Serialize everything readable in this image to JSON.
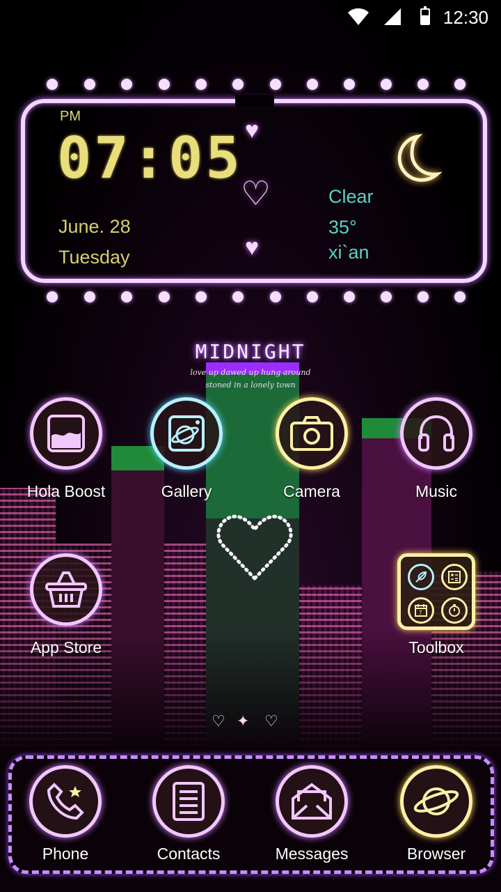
{
  "status_bar": {
    "time": "12:30"
  },
  "clock_widget": {
    "period": "PM",
    "time": "07:05",
    "date": "June. 28",
    "weekday": "Tuesday",
    "weather": {
      "condition": "Clear",
      "temperature": "35°",
      "city": "xi`an"
    }
  },
  "theme_label": {
    "title": "MIDNIGHT",
    "tagline_1": "love up dawed up hung around",
    "tagline_2": "stoned in a lonely town"
  },
  "apps": [
    {
      "label": "Hola Boost",
      "icon": "gallery-box-icon"
    },
    {
      "label": "Gallery",
      "icon": "planet-picture-icon"
    },
    {
      "label": "Camera",
      "icon": "camera-icon"
    },
    {
      "label": "Music",
      "icon": "headphones-icon"
    },
    {
      "label": "App Store",
      "icon": "shopping-basket-icon"
    },
    {
      "label": "Toolbox",
      "icon": "folder-icon"
    }
  ],
  "dock": [
    {
      "label": "Phone",
      "icon": "phone-icon"
    },
    {
      "label": "Contacts",
      "icon": "contacts-icon"
    },
    {
      "label": "Messages",
      "icon": "envelope-icon"
    },
    {
      "label": "Browser",
      "icon": "planet-icon"
    }
  ],
  "colors": {
    "neon_pink": "#f2c7ff",
    "neon_blue": "#b7f1ff",
    "neon_yellow": "#fff0a6",
    "clock_yellow": "#e8df7c",
    "weather_teal": "#5ed0c6",
    "dock_border": "#c98cff"
  }
}
